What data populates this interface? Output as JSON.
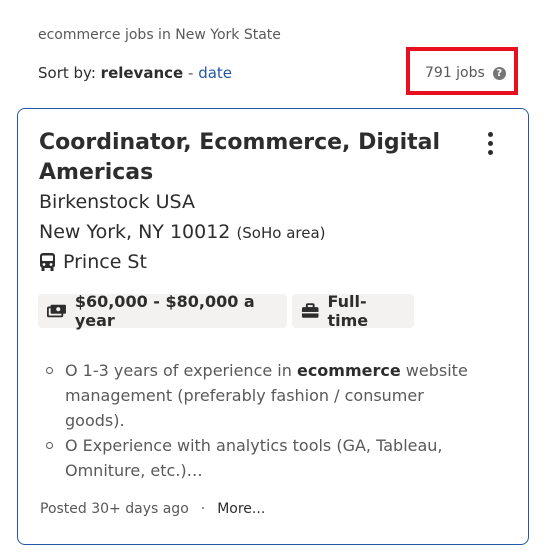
{
  "breadcrumb": "ecommerce jobs in New York State",
  "sort": {
    "prefix": "Sort by:",
    "active": "relevance",
    "separator": "-",
    "alternate": "date"
  },
  "job_count": "791 jobs",
  "job": {
    "title": "Coordinator, Ecommerce, Digital Americas",
    "company": "Birkenstock USA",
    "location": "New York, NY 10012",
    "area": "(SoHo area)",
    "transit": "Prince St",
    "salary": "$60,000 - $80,000 a year",
    "job_type": "Full-time",
    "snippets": [
      {
        "pre": "O 1-3 years of experience in ",
        "bold": "ecommerce",
        "post": " website management (preferably fashion / consumer goods)."
      },
      {
        "pre": "O Experience with analytics tools (GA, Tableau, Omniture, etc.)…",
        "bold": "",
        "post": ""
      }
    ],
    "posted": "Posted 30+ days ago",
    "footer_separator": "·",
    "more": "More..."
  },
  "colors": {
    "highlight_box": "#e8101f",
    "link": "#2557a7",
    "card_border": "#2557a7",
    "pill_bg": "#f3f2f1"
  },
  "icons": [
    "help-icon",
    "kebab-menu-icon",
    "bus-icon",
    "money-icon",
    "briefcase-icon"
  ]
}
